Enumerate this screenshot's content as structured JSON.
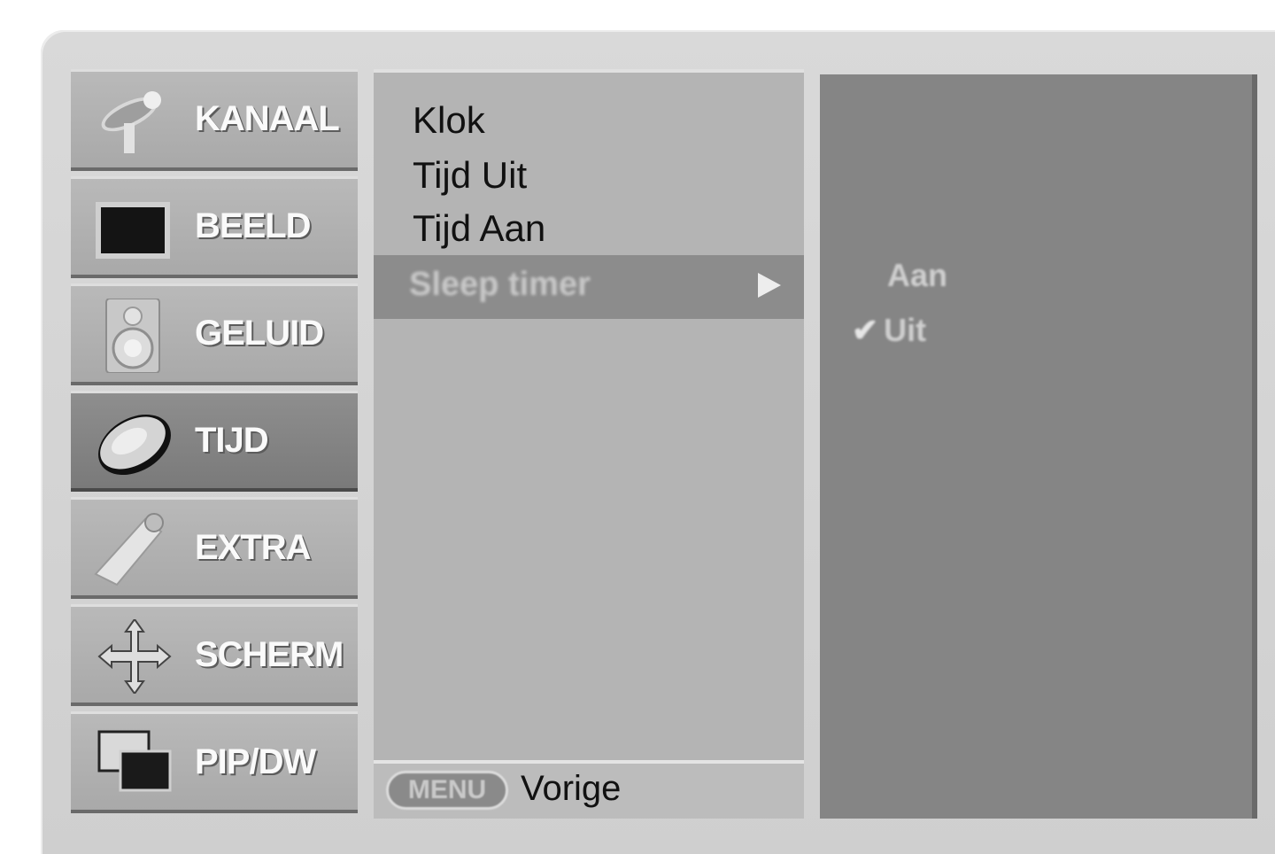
{
  "sidebar": {
    "items": [
      {
        "label": "KANAAL",
        "icon": "satellite-dish-icon",
        "active": false
      },
      {
        "label": "BEELD",
        "icon": "screen-icon",
        "active": false
      },
      {
        "label": "GELUID",
        "icon": "speaker-icon",
        "active": false
      },
      {
        "label": "TIJD",
        "icon": "clock-icon",
        "active": true
      },
      {
        "label": "EXTRA",
        "icon": "remote-control-icon",
        "active": false
      },
      {
        "label": "SCHERM",
        "icon": "move-arrows-icon",
        "active": false
      },
      {
        "label": "PIP/DW",
        "icon": "pip-icon",
        "active": false
      }
    ]
  },
  "submenu": {
    "items": [
      "Klok",
      "Tijd Uit",
      "Tijd Aan"
    ],
    "selected": "Sleep timer",
    "footer": {
      "button": "MENU",
      "label": "Vorige"
    }
  },
  "options": {
    "items": [
      {
        "label": "Aan",
        "checked": false
      },
      {
        "label": "Uit",
        "checked": true
      }
    ]
  },
  "colors": {
    "active_item": "#7f7f7f",
    "submenu_bg": "#b4b4b4",
    "options_bg": "#858585"
  }
}
